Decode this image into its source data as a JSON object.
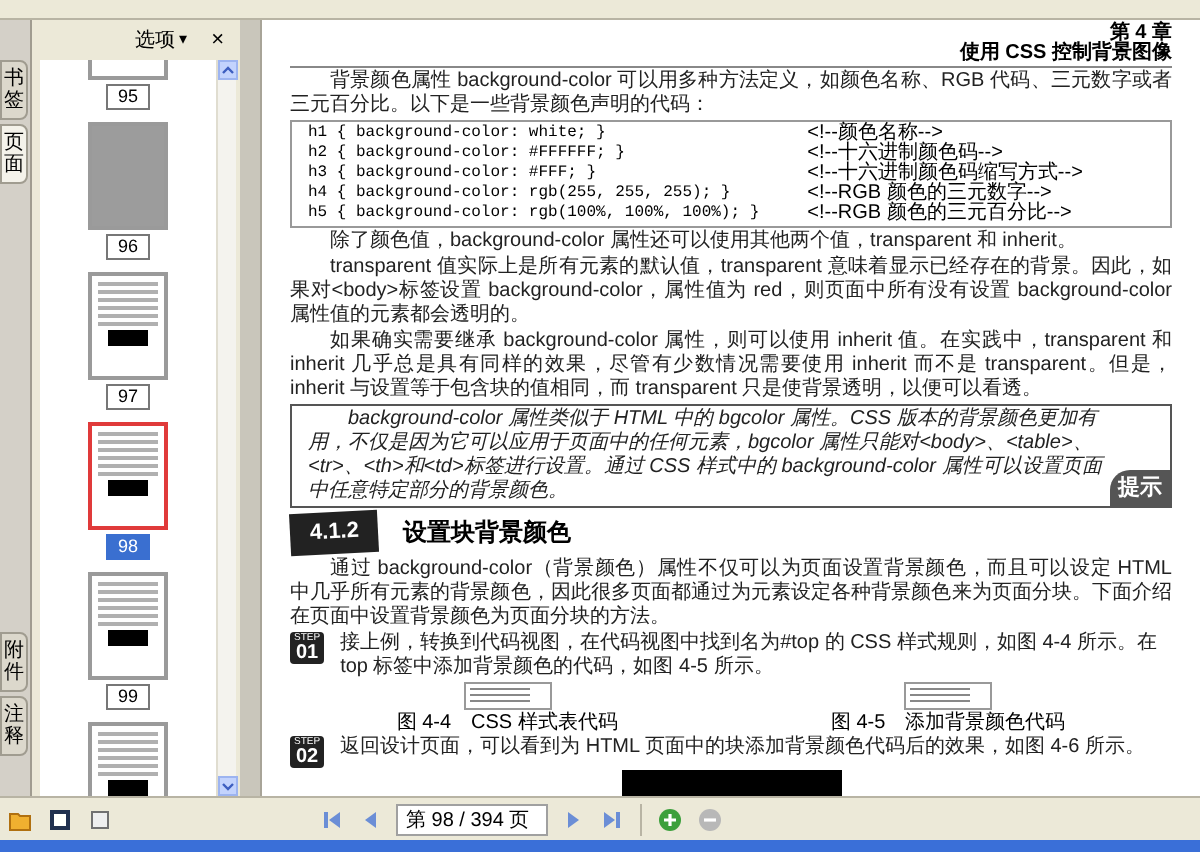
{
  "sidebar": {
    "tabs_top": [
      {
        "label": "书签",
        "selected": false
      },
      {
        "label": "页面",
        "selected": true
      }
    ],
    "tabs_bottom": [
      {
        "label": "附件",
        "selected": false
      },
      {
        "label": "注释",
        "selected": false
      }
    ],
    "options_label": "选项",
    "options_caret": "▾",
    "close": "×",
    "thumbnails": [
      {
        "page": "95",
        "kind": "blank",
        "selected": false
      },
      {
        "page": "96",
        "kind": "photo",
        "selected": false
      },
      {
        "page": "97",
        "kind": "document",
        "selected": false
      },
      {
        "page": "98",
        "kind": "document",
        "selected": true
      },
      {
        "page": "99",
        "kind": "document",
        "selected": false
      },
      {
        "kind": "document",
        "selected": false
      }
    ]
  },
  "page": {
    "chapter": "第 4 章",
    "chapter_title": "使用 CSS 控制背景图像",
    "blocks": [
      {
        "kind": "paragraph",
        "text": "背景颜色属性 background-color 可以用多种方法定义，如颜色名称、RGB 代码、三元数字或者三元百分比。以下是一些背景颜色声明的代码："
      },
      {
        "kind": "code",
        "lines": [
          {
            "code": "h1 { background-color: white; }",
            "comment": "<!--颜色名称-->"
          },
          {
            "code": "h2 { background-color: #FFFFFF; }",
            "comment": "<!--十六进制颜色码-->"
          },
          {
            "code": "h3 { background-color: #FFF; }",
            "comment": "<!--十六进制颜色码缩写方式-->"
          },
          {
            "code": "h4 { background-color: rgb(255, 255, 255); }",
            "comment": "<!--RGB 颜色的三元数字-->"
          },
          {
            "code": "h5 { background-color: rgb(100%, 100%, 100%); }",
            "comment": "<!--RGB 颜色的三元百分比-->"
          }
        ]
      },
      {
        "kind": "paragraph",
        "text": "除了颜色值，background-color 属性还可以使用其他两个值，transparent 和 inherit。"
      },
      {
        "kind": "paragraph",
        "text": "transparent 值实际上是所有元素的默认值，transparent 意味着显示已经存在的背景。因此，如果对<body>标签设置 background-color，属性值为 red，则页面中所有没有设置 background-color 属性值的元素都会透明的。"
      },
      {
        "kind": "paragraph",
        "text": "如果确实需要继承 background-color 属性，则可以使用 inherit 值。在实践中，transparent 和 inherit 几乎总是具有同样的效果，尽管有少数情况需要使用 inherit 而不是 transparent。但是，inherit 与设置等于包含块的值相同，而 transparent 只是使背景透明，以便可以看透。"
      },
      {
        "kind": "tip",
        "text": "background-color 属性类似于 HTML 中的 bgcolor 属性。CSS 版本的背景颜色更加有用，不仅是因为它可以应用于页面中的任何元素，bgcolor 属性只能对<body>、<table>、<tr>、<th>和<td>标签进行设置。通过 CSS 样式中的 background-color 属性可以设置页面中任意特定部分的背景颜色。",
        "label": "提示"
      },
      {
        "kind": "section",
        "number": "4.1.2",
        "title": "设置块背景颜色"
      },
      {
        "kind": "paragraph",
        "text": "通过 background-color（背景颜色）属性不仅可以为页面设置背景颜色，而且可以设定 HTML 中几乎所有元素的背景颜色，因此很多页面都通过为元素设定各种背景颜色来为页面分块。下面介绍在页面中设置背景颜色为页面分块的方法。"
      },
      {
        "kind": "step",
        "label": "STEP",
        "number": "01",
        "text": "接上例，转换到代码视图，在代码视图中找到名为#top 的 CSS 样式规则，如图 4-4 所示。在 top 标签中添加背景颜色的代码，如图 4-5 所示。"
      },
      {
        "kind": "figures",
        "items": [
          {
            "caption": "图 4-4　CSS 样式表代码"
          },
          {
            "caption": "图 4-5　添加背景颜色代码"
          }
        ]
      },
      {
        "kind": "step",
        "label": "STEP",
        "number": "02",
        "text": "返回设计页面，可以看到为 HTML 页面中的块添加背景颜色代码后的效果，如图 4-6 所示。"
      },
      {
        "kind": "screenshot"
      }
    ]
  },
  "toolbar": {
    "page_field": "第 98 / 394 页"
  }
}
